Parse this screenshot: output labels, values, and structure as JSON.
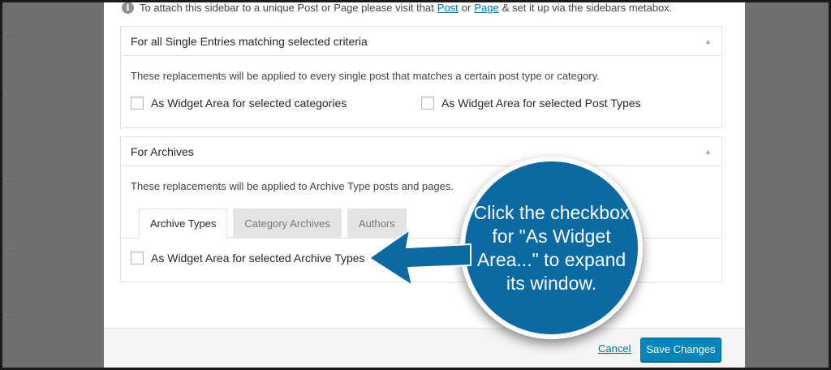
{
  "background": {
    "snippets": [
      "...",
      "...",
      "...",
      "...",
      "...",
      "..."
    ]
  },
  "notice": {
    "prefix": "To attach this sidebar to a unique Post or Page please visit that",
    "post_link": "Post",
    "or": "or",
    "page_link": "Page",
    "suffix": "& set it up via the sidebars metabox."
  },
  "single": {
    "title": "For all Single Entries matching selected criteria",
    "description": "These replacements will be applied to every single post that matches a certain post type or category.",
    "checkbox_categories": "As Widget Area for selected categories",
    "checkbox_post_types": "As Widget Area for selected Post Types"
  },
  "archives": {
    "title": "For Archives",
    "description": "These replacements will be applied to Archive Type posts and pages.",
    "tabs": [
      "Archive Types",
      "Category Archives",
      "Authors"
    ],
    "checkbox_archive_types": "As Widget Area for selected Archive Types"
  },
  "footer": {
    "cancel_label": "Cancel",
    "save_label": "Save Changes"
  },
  "callout": {
    "text": "Click the checkbox for \"As Widget Area...\" to expand its window."
  },
  "colors": {
    "accent": "#0085ba",
    "callout": "#0a6aa1",
    "link": "#0073aa"
  }
}
